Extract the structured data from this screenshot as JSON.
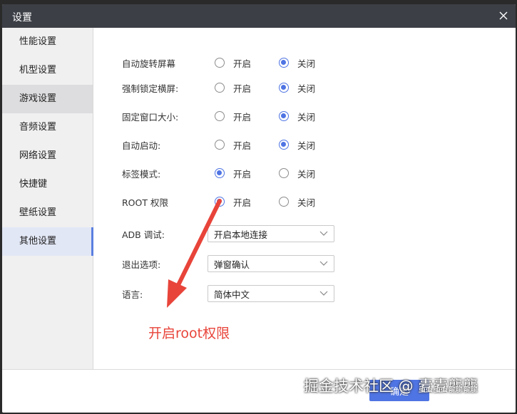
{
  "window": {
    "title": "设置"
  },
  "sidebar": {
    "items": [
      {
        "label": "性能设置"
      },
      {
        "label": "机型设置"
      },
      {
        "label": "游戏设置"
      },
      {
        "label": "音频设置"
      },
      {
        "label": "网络设置"
      },
      {
        "label": "快捷键"
      },
      {
        "label": "壁纸设置"
      },
      {
        "label": "其他设置"
      }
    ],
    "active_index": 7,
    "hover_index": 2
  },
  "settings": {
    "toggles": [
      {
        "label": "自动旋转屏幕",
        "on_label": "开启",
        "off_label": "关闭",
        "selected": "off"
      },
      {
        "label": "强制锁定横屏:",
        "on_label": "开启",
        "off_label": "关闭",
        "selected": "off"
      },
      {
        "label": "固定窗口大小:",
        "on_label": "开启",
        "off_label": "关闭",
        "selected": "off"
      },
      {
        "label": "自动启动:",
        "on_label": "开启",
        "off_label": "关闭",
        "selected": "off"
      },
      {
        "label": "标签模式:",
        "on_label": "开启",
        "off_label": "关闭",
        "selected": "on"
      },
      {
        "label": "ROOT 权限",
        "on_label": "开启",
        "off_label": "关闭",
        "selected": "on"
      }
    ],
    "selects": [
      {
        "label": "ADB 调试:",
        "value": "开启本地连接"
      },
      {
        "label": "退出选项:",
        "value": "弹窗确认"
      },
      {
        "label": "语言:",
        "value": "简体中文"
      }
    ]
  },
  "annotation": {
    "text": "开启root权限",
    "color": "#e8443a"
  },
  "footer": {
    "ok_label": "确定",
    "watermark": "掘金技术社区 @ 蠹蠹龘龘"
  },
  "colors": {
    "accent": "#4f74e3",
    "titlebar": "#3c3f46"
  }
}
